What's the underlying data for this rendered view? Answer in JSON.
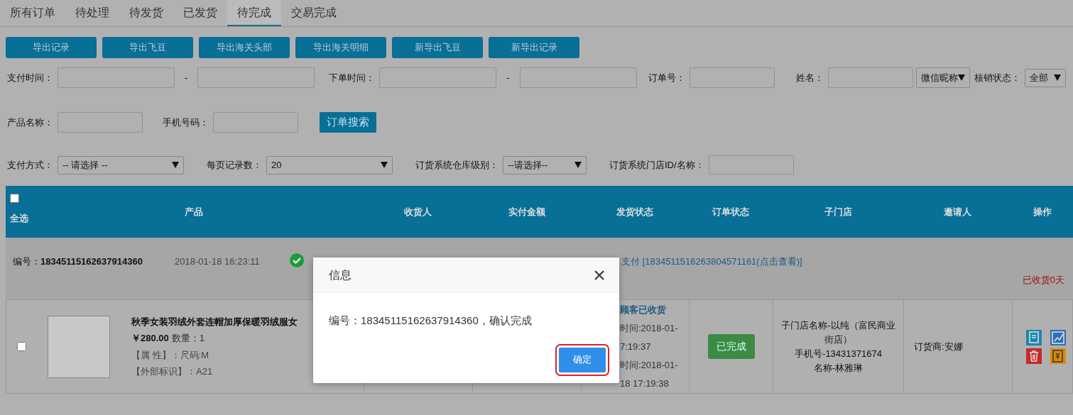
{
  "tabs": [
    {
      "label": "所有订单",
      "selected": false
    },
    {
      "label": "待处理",
      "selected": false
    },
    {
      "label": "待发货",
      "selected": false
    },
    {
      "label": "已发货",
      "selected": false
    },
    {
      "label": "待完成",
      "selected": true
    },
    {
      "label": "交易完成",
      "selected": false
    }
  ],
  "export_buttons": [
    "导出记录",
    "导出飞豆",
    "导出海关头部",
    "导出海关明细",
    "新导出飞豆",
    "新导出记录"
  ],
  "filters": {
    "pay_time_label": "支付时间：",
    "order_time_label": "下单时间：",
    "range_sep": "-",
    "order_no_label": "订单号：",
    "name_label": "姓名：",
    "name_type": "微信昵称",
    "verify_label": "核销状态：",
    "verify_value": "全部",
    "product_label": "产品名称：",
    "phone_label": "手机号码：",
    "search_button": "订单搜索",
    "pay_method_label": "支付方式：",
    "pay_method_value": "-- 请选择 --",
    "page_size_label": "每页记录数：",
    "page_size_value": "20",
    "warehouse_label": "订货系统仓库级别：",
    "warehouse_value": "--请选择--",
    "store_label": "订货系统门店ID/名称："
  },
  "table": {
    "select_all": {
      "label": "全选",
      "checked": false
    },
    "columns": [
      "产品",
      "收货人",
      "实付金额",
      "发货状态",
      "订单状态",
      "子门店",
      "邀请人",
      "操作"
    ],
    "order": {
      "no_label": "编号：",
      "no": "18345115162637914360",
      "time": "2018-01-18 16:23:11",
      "payment": "支付 [1834511516263804571161(点击查看)]",
      "received_days": "已收货0天",
      "item": {
        "checked": false,
        "title": "秋季女装羽绒外套连帽加厚保暖羽绒服女",
        "price": "￥280.00",
        "qty": "数量：1",
        "attr": "【属 性】：尺码:M",
        "ext": "【外部标识】：A21",
        "ship_status": "顾客已收货",
        "ship_lines": [
          "时间:2018-01-",
          "7:19:37",
          "时间:2018-01-",
          "18 17:19:38"
        ],
        "order_status": "已完成",
        "store_lines": [
          "子门店名称-以纯（富民商业街店）",
          "手机号-13431371674",
          "名称-林雅琳"
        ],
        "inviter": "订货商:安娜"
      }
    }
  },
  "dialog": {
    "title": "信息",
    "message": "编号：18345115162637914360，确认完成",
    "confirm": "确定"
  }
}
